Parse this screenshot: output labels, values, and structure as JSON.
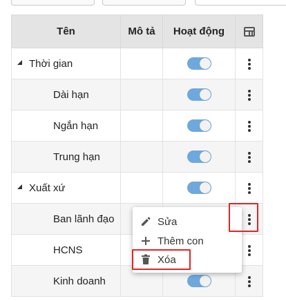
{
  "table": {
    "headers": {
      "name": "Tên",
      "description": "Mô tả",
      "active": "Hoạt động"
    },
    "column_settings_icon": "table-columns-icon",
    "rows": [
      {
        "name": "Thời gian",
        "level": 0,
        "expanded": true,
        "description": "",
        "active": true
      },
      {
        "name": "Dài hạn",
        "level": 1,
        "description": "",
        "active": true
      },
      {
        "name": "Ngắn hạn",
        "level": 1,
        "description": "",
        "active": true
      },
      {
        "name": "Trung hạn",
        "level": 1,
        "description": "",
        "active": true
      },
      {
        "name": "Xuất xứ",
        "level": 0,
        "expanded": true,
        "description": "",
        "active": true
      },
      {
        "name": "Ban lãnh đạo",
        "level": 1,
        "description": "",
        "active": true
      },
      {
        "name": "HCNS",
        "level": 1,
        "description": "",
        "active": true
      },
      {
        "name": "Kinh doanh",
        "level": 1,
        "description": "",
        "active": true
      }
    ]
  },
  "context_menu": {
    "items": [
      {
        "label": "Sửa",
        "icon": "pencil-icon"
      },
      {
        "label": "Thêm con",
        "icon": "plus-icon"
      },
      {
        "label": "Xóa",
        "icon": "trash-icon"
      }
    ]
  },
  "colors": {
    "toggle_on": "#6fa8dc",
    "highlight": "#e02424",
    "header_bg": "#e4e4e4"
  }
}
